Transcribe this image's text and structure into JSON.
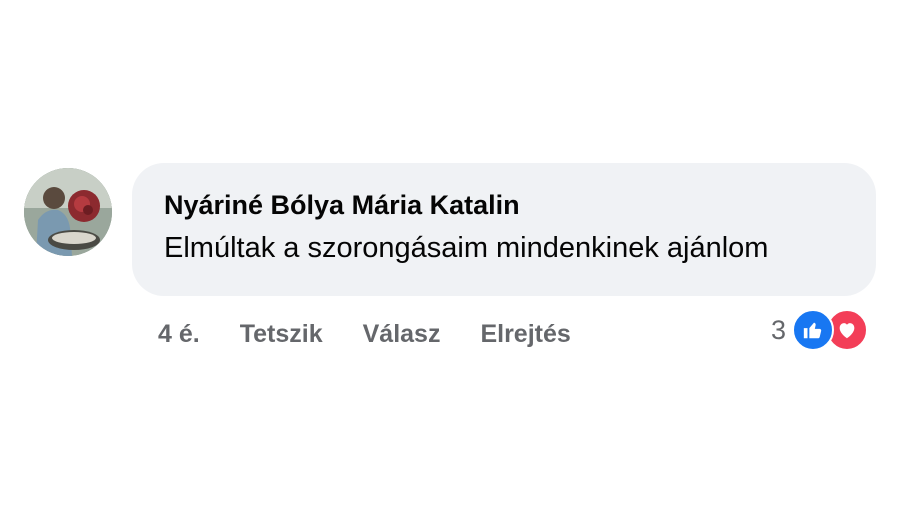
{
  "comment": {
    "author": "Nyáriné Bólya Mária Katalin",
    "text": "Elmúltak a szorongásaim mindenkinek ajánlom",
    "time": "4 é.",
    "actions": {
      "like": "Tetszik",
      "reply": "Válasz",
      "hide": "Elrejtés"
    },
    "reactions": {
      "count": "3",
      "types": [
        "like-icon",
        "heart-icon"
      ]
    }
  },
  "colors": {
    "bubble": "#f0f2f5",
    "text": "#050505",
    "secondary": "#65676b",
    "like": "#1877f2",
    "love": "#f33e58"
  }
}
